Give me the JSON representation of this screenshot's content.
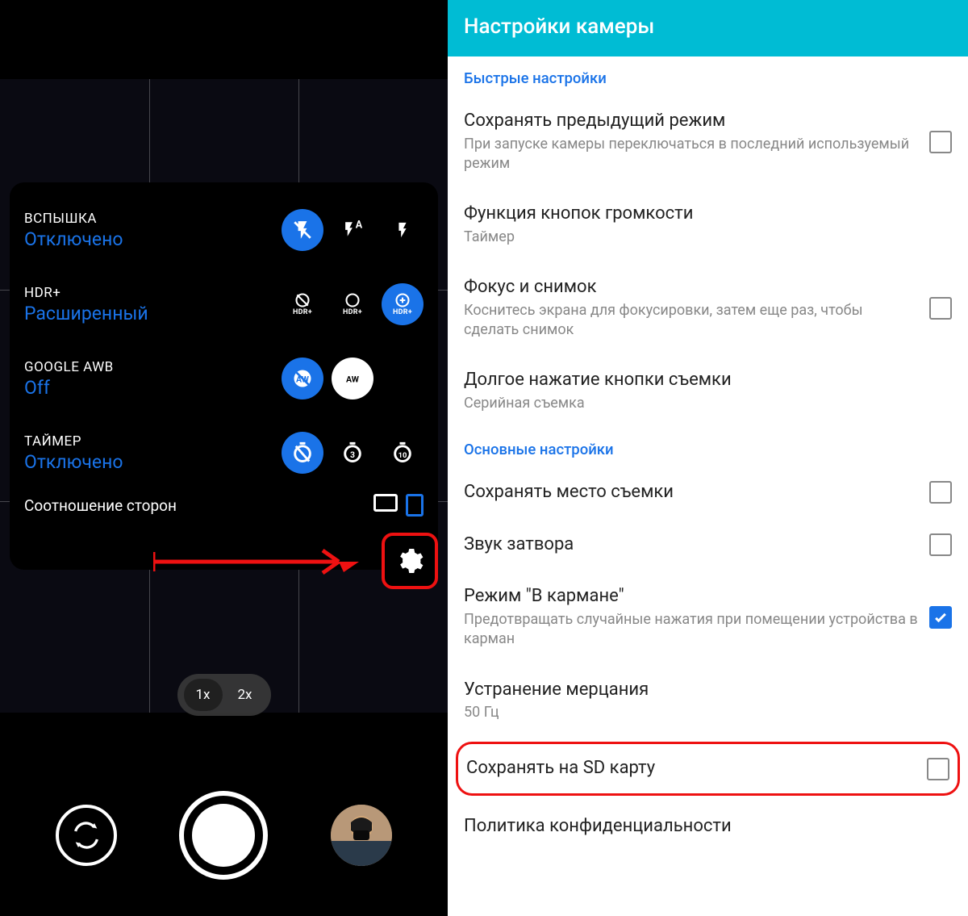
{
  "camera": {
    "quick": [
      {
        "label": "ВСПЫШКА",
        "value": "Отключено",
        "options": [
          "flash-off",
          "flash-auto",
          "flash-on"
        ],
        "selected": 0
      },
      {
        "label": "HDR+",
        "value": "Расширенный",
        "options": [
          "hdr-off",
          "hdr-on",
          "hdr-enhanced"
        ],
        "selected": 2
      },
      {
        "label": "GOOGLE AWB",
        "value": "Off",
        "options": [
          "awb-off",
          "awb-on"
        ],
        "selected": 0
      },
      {
        "label": "ТАЙМЕР",
        "value": "Отключено",
        "options": [
          "timer-off",
          "timer-3s",
          "timer-10s"
        ],
        "selected": 0
      }
    ],
    "aspect_label": "Соотношение сторон",
    "zoom": {
      "options": [
        "1x",
        "2x"
      ],
      "active": 0
    }
  },
  "settings": {
    "title": "Настройки камеры",
    "sections": {
      "quick": {
        "title": "Быстрые настройки",
        "items": [
          {
            "title": "Сохранять предыдущий режим",
            "sub": "При запуске камеры переключаться в последний используемый режим",
            "checkbox": true,
            "checked": false
          },
          {
            "title": "Функция кнопок громкости",
            "sub": "Таймер",
            "checkbox": false
          },
          {
            "title": "Фокус и снимок",
            "sub": "Коснитесь экрана для фокусировки, затем еще раз, чтобы сделать снимок",
            "checkbox": true,
            "checked": false
          },
          {
            "title": "Долгое нажатие кнопки съемки",
            "sub": "Серийная съемка",
            "checkbox": false
          }
        ]
      },
      "main": {
        "title": "Основные настройки",
        "items": [
          {
            "title": "Сохранять место съемки",
            "sub": "",
            "checkbox": true,
            "checked": false
          },
          {
            "title": "Звук затвора",
            "sub": "",
            "checkbox": true,
            "checked": false
          },
          {
            "title": "Режим \"В кармане\"",
            "sub": "Предотвращать случайные нажатия при помещении устройства в карман",
            "checkbox": true,
            "checked": true
          },
          {
            "title": "Устранение мерцания",
            "sub": "50 Гц",
            "checkbox": false
          },
          {
            "title": "Сохранять на SD карту",
            "sub": "",
            "checkbox": true,
            "checked": false,
            "highlighted": true
          },
          {
            "title": "Политика конфиденциальности",
            "sub": "",
            "checkbox": false
          }
        ]
      }
    }
  }
}
